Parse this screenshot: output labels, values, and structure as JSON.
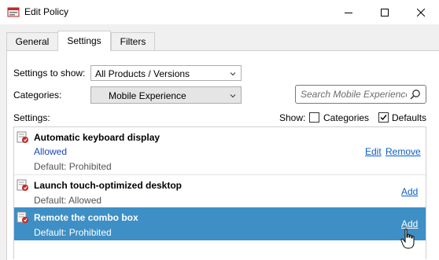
{
  "window": {
    "title": "Edit Policy",
    "icons": {
      "app": "policy-app-icon",
      "minimize": "minimize-icon",
      "maximize": "maximize-icon",
      "close": "close-icon"
    }
  },
  "tabs": [
    {
      "label": "General",
      "active": false
    },
    {
      "label": "Settings",
      "active": true
    },
    {
      "label": "Filters",
      "active": false
    }
  ],
  "settings_to_show": {
    "label": "Settings to show:",
    "value": "All Products / Versions"
  },
  "categories": {
    "label": "Categories:",
    "value": "Mobile Experience"
  },
  "search": {
    "placeholder": "Search Mobile Experience"
  },
  "settings_label": "Settings:",
  "show": {
    "label": "Show:",
    "categories_label": "Categories",
    "categories_checked": false,
    "defaults_label": "Defaults",
    "defaults_checked": true
  },
  "settings_list": [
    {
      "name": "Automatic keyboard display",
      "value": "Allowed",
      "default": "Default: Prohibited",
      "actions": [
        "Edit",
        "Remove"
      ]
    },
    {
      "name": "Launch touch-optimized desktop",
      "default": "Default: Allowed",
      "actions": [
        "Add"
      ]
    },
    {
      "name": "Remote the combo box",
      "default": "Default: Prohibited",
      "actions": [
        "Add"
      ],
      "selected": true
    }
  ],
  "colors": {
    "selection": "#3d8fc6",
    "link": "#0b5fc5",
    "value_text": "#1a46b8"
  }
}
